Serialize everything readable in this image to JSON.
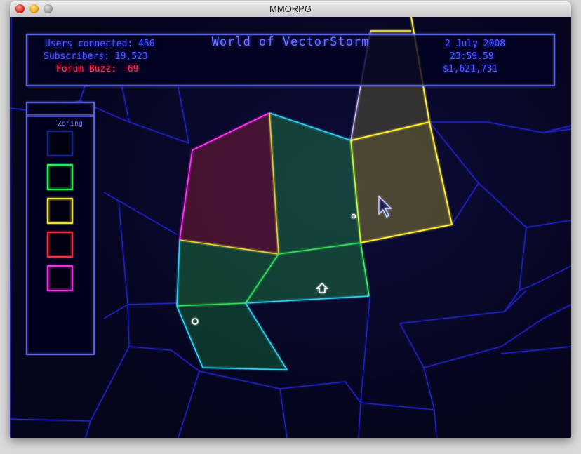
{
  "window": {
    "title": "MMORPG"
  },
  "hud": {
    "title": "World of VectorStorm",
    "users_connected": "Users connected: 456",
    "subscribers": "Subscribers: 19,523",
    "forum_buzz": "Forum Buzz: -69",
    "date": "2 July 2008",
    "time": "23:59.59",
    "money": "$1,621,731"
  },
  "zoning": {
    "label": "Zoning",
    "swatches": [
      {
        "name": "empty",
        "color": "#1a2a88"
      },
      {
        "name": "green",
        "color": "#22ff55"
      },
      {
        "name": "yellow",
        "color": "#ffee33"
      },
      {
        "name": "red",
        "color": "#ff3344"
      },
      {
        "name": "magenta",
        "color": "#ff33ee"
      }
    ]
  },
  "colors": {
    "hud": "#4a54ff",
    "buzz": "#ff2a4a",
    "grid": "#2a2ad8"
  }
}
